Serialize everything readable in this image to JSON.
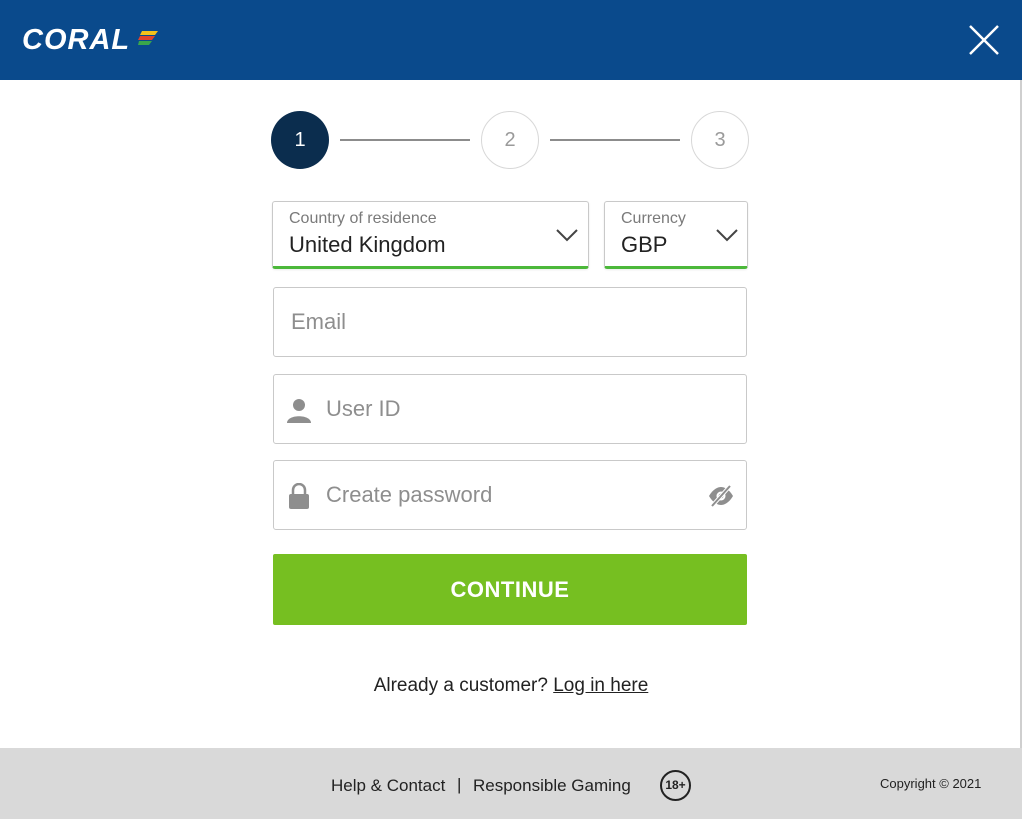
{
  "header": {
    "logo_text": "CORAL",
    "brand_color": "#0a4a8c",
    "close_icon": "close-icon"
  },
  "stepper": {
    "steps": [
      "1",
      "2",
      "3"
    ],
    "current": 1
  },
  "form": {
    "country": {
      "label": "Country of residence",
      "value": "United Kingdom"
    },
    "currency": {
      "label": "Currency",
      "value": "GBP"
    },
    "email": {
      "placeholder": "Email",
      "value": ""
    },
    "user_id": {
      "placeholder": "User ID",
      "value": ""
    },
    "password": {
      "placeholder": "Create password",
      "value": ""
    },
    "continue_label": "CONTINUE",
    "accent_color": "#76bf21"
  },
  "login": {
    "prompt": "Already a customer?",
    "link": "Log in here"
  },
  "footer": {
    "help_link": "Help & Contact",
    "separator": "|",
    "responsible_link": "Responsible Gaming",
    "age_badge": "18+",
    "copyright": "Copyright © 2021"
  }
}
